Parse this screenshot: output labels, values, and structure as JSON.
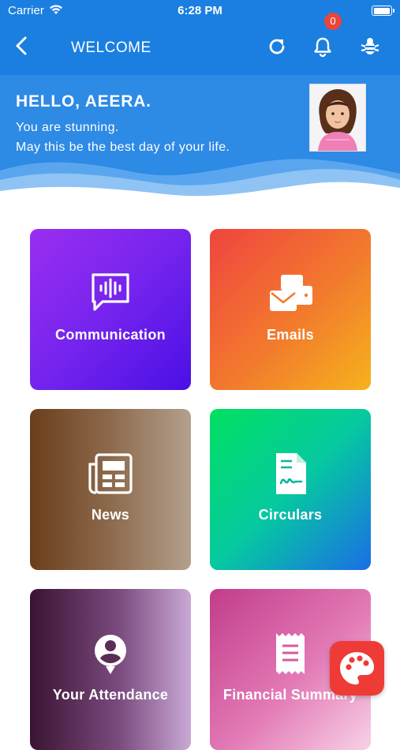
{
  "status_bar": {
    "carrier": "Carrier",
    "time": "6:28 PM"
  },
  "nav": {
    "title": "WELCOME",
    "notification_count": "0",
    "icons": [
      "back-icon",
      "refresh-icon",
      "bell-icon",
      "bug-icon"
    ]
  },
  "greeting": {
    "hello": "HELLO, AEERA.",
    "line1": "You are stunning.",
    "line2": "May this be the best day of your life."
  },
  "tiles": [
    {
      "label": "Communication",
      "icon": "chat-icon"
    },
    {
      "label": "Emails",
      "icon": "mail-icon"
    },
    {
      "label": "News",
      "icon": "newspaper-icon"
    },
    {
      "label": "Circulars",
      "icon": "document-icon"
    },
    {
      "label": "Your Attendance",
      "icon": "attendance-icon"
    },
    {
      "label": "Financial Summary",
      "icon": "receipt-icon"
    }
  ],
  "fab": {
    "icon": "palette-icon"
  },
  "colors": {
    "header": "#1a7fe0",
    "hero": "#2d8ae5",
    "badge": "#e8453c",
    "fab": "#ef3b36"
  }
}
